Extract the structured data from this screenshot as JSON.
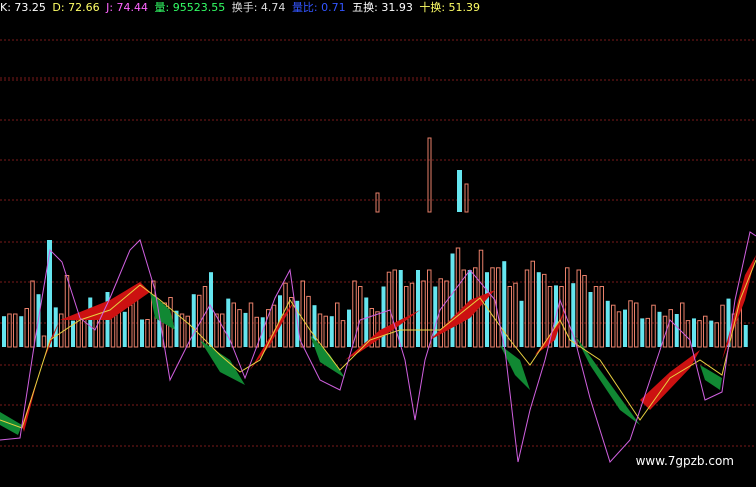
{
  "header": {
    "k_label": "K: 73.25",
    "d_label": "D: 72.66",
    "j_label": "J: 74.44",
    "vol_label": "量: 95523.55",
    "turnover_label": "换手: 4.74",
    "ratio_label": "量比: 0.71",
    "five_label": "五换: 31.93",
    "ten_label": "十换: 51.39"
  },
  "colors": {
    "background": "#000000",
    "k": "#ffffff",
    "d": "#ffff66",
    "j": "#ff66ff",
    "vol": "#33ff66",
    "turnover": "#dddddd",
    "ratio": "#3355ff",
    "five": "#ffffff",
    "ten": "#ffff66",
    "grid": "#7a1a1a",
    "bar_up": "#e8806a",
    "bar_down": "#66e6f0",
    "band_red": "#cc1111",
    "band_green": "#118833",
    "line_purple": "#d060e0",
    "line_yellow": "#e8d040"
  },
  "watermark": "www.7gpzb.com",
  "chart_data": {
    "type": "bar",
    "bars": [
      [
        0,
        0.28
      ],
      [
        1,
        0.3
      ],
      [
        2,
        0.3
      ],
      [
        3,
        0.28
      ],
      [
        4,
        0.35
      ],
      [
        5,
        0.6
      ],
      [
        6,
        0.48
      ],
      [
        7,
        0.1
      ],
      [
        8,
        0.55
      ],
      [
        9,
        0.36
      ],
      [
        10,
        0.3
      ],
      [
        11,
        0.65
      ],
      [
        12,
        0.24
      ],
      [
        13,
        0.27
      ],
      [
        14,
        0.3
      ],
      [
        15,
        0.45
      ],
      [
        16,
        0.28
      ],
      [
        17,
        0.28
      ],
      [
        18,
        0.5
      ],
      [
        19,
        0.42
      ],
      [
        20,
        0.34
      ],
      [
        21,
        0.32
      ],
      [
        22,
        0.38
      ],
      [
        23,
        0.55
      ],
      [
        24,
        0.25
      ],
      [
        25,
        0.25
      ],
      [
        26,
        0.6
      ],
      [
        27,
        0.3
      ],
      [
        28,
        0.4
      ],
      [
        29,
        0.45
      ],
      [
        30,
        0.33
      ],
      [
        31,
        0.3
      ],
      [
        32,
        0.28
      ],
      [
        33,
        0.48
      ],
      [
        34,
        0.47
      ],
      [
        35,
        0.55
      ],
      [
        36,
        0.68
      ],
      [
        37,
        0.3
      ],
      [
        38,
        0.3
      ],
      [
        39,
        0.44
      ],
      [
        40,
        0.4
      ],
      [
        41,
        0.34
      ],
      [
        42,
        0.31
      ],
      [
        43,
        0.4
      ],
      [
        44,
        0.27
      ],
      [
        45,
        0.27
      ],
      [
        46,
        0.34
      ],
      [
        47,
        0.38
      ],
      [
        48,
        0.47
      ],
      [
        49,
        0.58
      ],
      [
        50,
        0.45
      ],
      [
        51,
        0.42
      ],
      [
        52,
        0.6
      ],
      [
        53,
        0.46
      ],
      [
        54,
        0.38
      ],
      [
        55,
        0.3
      ],
      [
        56,
        0.28
      ],
      [
        57,
        0.28
      ],
      [
        58,
        0.4
      ],
      [
        59,
        0.24
      ],
      [
        60,
        0.34
      ],
      [
        61,
        0.6
      ],
      [
        62,
        0.55
      ],
      [
        63,
        0.45
      ],
      [
        64,
        0.35
      ],
      [
        65,
        0.32
      ],
      [
        66,
        0.55
      ],
      [
        67,
        0.68
      ],
      [
        68,
        0.7
      ],
      [
        69,
        0.7
      ],
      [
        70,
        0.55
      ],
      [
        71,
        0.58
      ],
      [
        72,
        0.7
      ],
      [
        73,
        0.6
      ],
      [
        74,
        0.7
      ],
      [
        75,
        0.55
      ],
      [
        76,
        0.62
      ],
      [
        77,
        0.6
      ],
      [
        78,
        0.85
      ],
      [
        79,
        0.9
      ],
      [
        80,
        0.7
      ],
      [
        81,
        0.7
      ],
      [
        82,
        0.72
      ],
      [
        83,
        0.88
      ],
      [
        84,
        0.68
      ],
      [
        85,
        0.72
      ],
      [
        86,
        0.72
      ],
      [
        87,
        0.78
      ],
      [
        88,
        0.55
      ],
      [
        89,
        0.58
      ],
      [
        90,
        0.42
      ],
      [
        91,
        0.7
      ],
      [
        92,
        0.78
      ],
      [
        93,
        0.68
      ],
      [
        94,
        0.66
      ],
      [
        95,
        0.55
      ],
      [
        96,
        0.56
      ],
      [
        97,
        0.55
      ],
      [
        98,
        0.72
      ],
      [
        99,
        0.58
      ],
      [
        100,
        0.7
      ],
      [
        101,
        0.65
      ],
      [
        102,
        0.5
      ],
      [
        103,
        0.55
      ],
      [
        104,
        0.55
      ],
      [
        105,
        0.42
      ],
      [
        106,
        0.38
      ],
      [
        107,
        0.32
      ],
      [
        108,
        0.34
      ],
      [
        109,
        0.42
      ],
      [
        110,
        0.4
      ],
      [
        111,
        0.26
      ],
      [
        112,
        0.26
      ],
      [
        113,
        0.38
      ],
      [
        114,
        0.32
      ],
      [
        115,
        0.28
      ],
      [
        116,
        0.34
      ],
      [
        117,
        0.3
      ],
      [
        118,
        0.4
      ],
      [
        119,
        0.24
      ],
      [
        120,
        0.26
      ],
      [
        121,
        0.24
      ],
      [
        122,
        0.28
      ],
      [
        123,
        0.24
      ],
      [
        124,
        0.22
      ],
      [
        125,
        0.38
      ],
      [
        126,
        0.44
      ],
      [
        127,
        0.3
      ],
      [
        128,
        0.4
      ],
      [
        129,
        0.2
      ]
    ],
    "ylim": [
      0,
      1
    ]
  }
}
